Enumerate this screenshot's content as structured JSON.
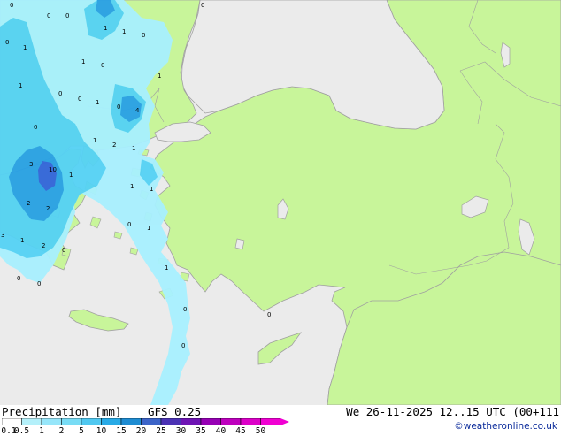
{
  "map": {
    "colors": {
      "sea": "#ebebeb",
      "land": "#c8f59a",
      "coast": "#a0a0a0",
      "precip_light": "#a8f0ff",
      "precip_mid": "#55d2f5",
      "precip_heavy": "#28a0e6",
      "precip_core": "#3264dc"
    },
    "value_labels": [
      {
        "text": "0"
      },
      {
        "text": "0"
      },
      {
        "text": "0"
      },
      {
        "text": "1"
      },
      {
        "text": "1"
      },
      {
        "text": "0"
      },
      {
        "text": "0"
      },
      {
        "text": "1"
      },
      {
        "text": "1"
      },
      {
        "text": "1"
      },
      {
        "text": "0"
      },
      {
        "text": "1"
      },
      {
        "text": "0"
      },
      {
        "text": "0"
      },
      {
        "text": "1"
      },
      {
        "text": "0"
      },
      {
        "text": "4"
      },
      {
        "text": "0"
      },
      {
        "text": "1"
      },
      {
        "text": "2"
      },
      {
        "text": "1"
      },
      {
        "text": "3"
      },
      {
        "text": "10"
      },
      {
        "text": "1"
      },
      {
        "text": "1"
      },
      {
        "text": "1"
      },
      {
        "text": "2"
      },
      {
        "text": "2"
      },
      {
        "text": "0"
      },
      {
        "text": "1"
      },
      {
        "text": "3"
      },
      {
        "text": "1"
      },
      {
        "text": "2"
      },
      {
        "text": "0"
      },
      {
        "text": "0"
      },
      {
        "text": "0"
      },
      {
        "text": "1"
      },
      {
        "text": "0"
      },
      {
        "text": "0"
      },
      {
        "text": "0"
      },
      {
        "text": "0"
      }
    ]
  },
  "footer": {
    "title": "Precipitation [mm]",
    "model": "GFS 0.25",
    "datetime": "We 26-11-2025 12..15 UTC (00+111",
    "credit": "©weatheronline.co.uk"
  },
  "legend": {
    "ticks": [
      "0.1",
      "0.5",
      "1",
      "2",
      "5",
      "10",
      "15",
      "20",
      "25",
      "30",
      "35",
      "40",
      "45",
      "50"
    ],
    "colors": [
      "#ffffff",
      "#b4f0fa",
      "#96e6fa",
      "#78dcf5",
      "#50c8f0",
      "#28aae6",
      "#1e8cd2",
      "#3c64c8",
      "#4b32b4",
      "#6e14b4",
      "#9600b4",
      "#be00be",
      "#dc00c8",
      "#f000d2"
    ]
  }
}
